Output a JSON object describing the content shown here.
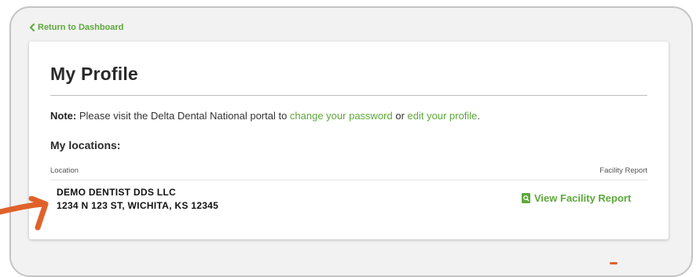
{
  "nav": {
    "back_label": "Return to Dashboard"
  },
  "profile": {
    "title": "My Profile",
    "note_label": "Note:",
    "note_text_1": " Please visit the Delta Dental National portal to ",
    "change_password_link": "change your password",
    "note_text_2": " or ",
    "edit_profile_link": "edit your profile",
    "note_text_3": "."
  },
  "locations": {
    "heading": "My locations:",
    "columns": {
      "location": "Location",
      "facility_report": "Facility Report"
    },
    "rows": [
      {
        "name": "DEMO DENTIST DDS LLC",
        "address": "1234 N 123 ST, WICHITA, KS 12345",
        "action_label": "View Facility Report"
      }
    ]
  },
  "icons": {
    "back": "chevron-left-icon",
    "report": "document-search-icon",
    "annotation": "pointer-arrow-icon"
  },
  "colors": {
    "accent_green": "#5da83a",
    "annotation_orange": "#e0622a",
    "frame_background": "#f2f2f2"
  }
}
